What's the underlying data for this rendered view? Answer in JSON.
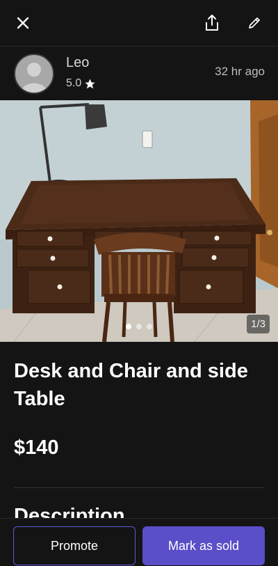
{
  "header": {
    "close_icon": "close-icon",
    "share_icon": "share-icon",
    "edit_icon": "edit-pencil-icon"
  },
  "seller": {
    "name": "Leo",
    "rating": "5.0",
    "rating_icon": "star-icon",
    "posted": "32 hr  ago"
  },
  "photo": {
    "counter": "1/3",
    "current_index": 1,
    "total": 3
  },
  "listing": {
    "title": "Desk and Chair and side Table",
    "price": "$140",
    "description_heading": "Description"
  },
  "actions": {
    "promote_label": "Promote",
    "sold_label": "Mark as sold"
  },
  "colors": {
    "background": "#141414",
    "primary": "#5b4ec9",
    "outline": "#5a5ad6"
  }
}
